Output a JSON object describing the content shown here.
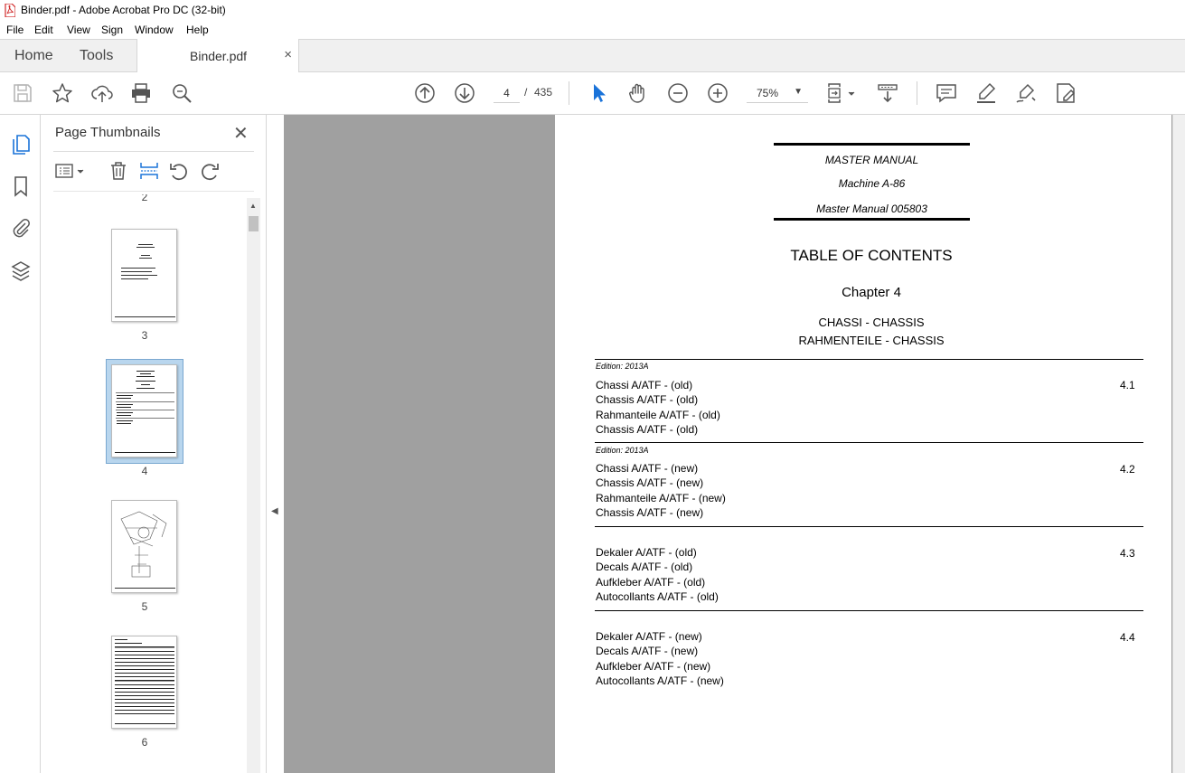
{
  "window": {
    "title": "Binder.pdf - Adobe Acrobat Pro DC (32-bit)"
  },
  "menu": [
    "File",
    "Edit",
    "View",
    "Sign",
    "Window",
    "Help"
  ],
  "tabs": {
    "home": "Home",
    "tools": "Tools",
    "document": "Binder.pdf",
    "close": "×"
  },
  "toolbar": {
    "page_current": "4",
    "page_separator": "/",
    "page_total": "435",
    "zoom": "75%"
  },
  "panel": {
    "title": "Page Thumbnails",
    "close": "✕",
    "thumbnails": [
      {
        "label": "2"
      },
      {
        "label": "3"
      },
      {
        "label": "4",
        "selected": true
      },
      {
        "label": "5"
      },
      {
        "label": "6"
      }
    ]
  },
  "document": {
    "header": [
      "MASTER MANUAL",
      "Machine A-86",
      "Master Manual 005803"
    ],
    "toc_title": "TABLE OF CONTENTS",
    "chapter": "Chapter 4",
    "subtitle_1": "CHASSI - CHASSIS",
    "subtitle_2": "RAHMENTEILE - CHASSIS",
    "sections": [
      {
        "edition": "Edition: 2013A",
        "number": "4.1",
        "lines": [
          "Chassi A/ATF - (old)",
          "Chassis A/ATF - (old)",
          "Rahmanteile A/ATF - (old)",
          "Chassis A/ATF - (old)"
        ]
      },
      {
        "edition": "Edition: 2013A",
        "number": "4.2",
        "lines": [
          "Chassi A/ATF - (new)",
          "Chassis A/ATF - (new)",
          "Rahmanteile A/ATF - (new)",
          "Chassis A/ATF - (new)"
        ]
      },
      {
        "edition": "",
        "number": "4.3",
        "lines": [
          "Dekaler A/ATF - (old)",
          "Decals A/ATF - (old)",
          "Aufkleber A/ATF - (old)",
          "Autocollants A/ATF - (old)"
        ]
      },
      {
        "edition": "",
        "number": "4.4",
        "lines": [
          "Dekaler A/ATF - (new)",
          "Decals A/ATF - (new)",
          "Aufkleber A/ATF - (new)",
          "Autocollants A/ATF - (new)"
        ]
      }
    ]
  },
  "colors": {
    "accent_blue": "#1a73d9",
    "selection": "#b9d6ee",
    "pdf_red": "#d12b2b",
    "doc_bg": "#a0a0a0"
  }
}
